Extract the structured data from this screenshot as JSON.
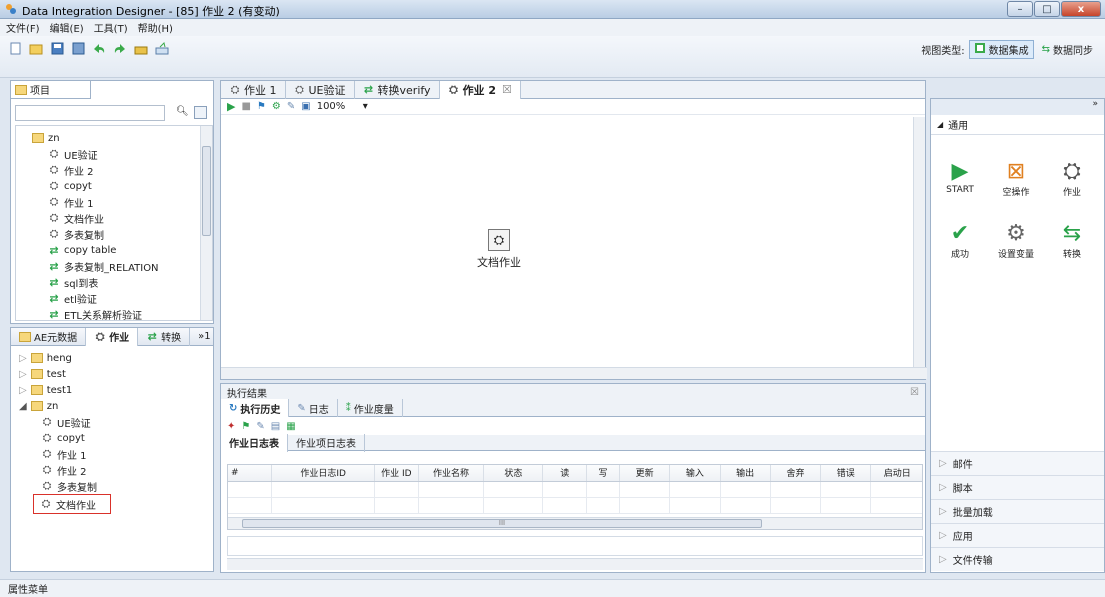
{
  "window": {
    "title": "Data Integration Designer - [85] 作业 2 (有变动)",
    "minimize": "–",
    "maximize": "□",
    "close": "x"
  },
  "menu": [
    "文件(F)",
    "编辑(E)",
    "工具(T)",
    "帮助(H)"
  ],
  "toolbar": {
    "view_type_label": "视图类型:",
    "view_integration": "数据集成",
    "view_sync": "数据同步"
  },
  "project_panel": {
    "title": "项目",
    "search_value": "",
    "root": "zn",
    "items": [
      {
        "label": "UE验证",
        "type": "job"
      },
      {
        "label": "作业 2",
        "type": "job"
      },
      {
        "label": "copyt",
        "type": "job"
      },
      {
        "label": "作业 1",
        "type": "job"
      },
      {
        "label": "文档作业",
        "type": "job"
      },
      {
        "label": "多表复制",
        "type": "job"
      },
      {
        "label": "copy table",
        "type": "trans"
      },
      {
        "label": "多表复制_RELATION",
        "type": "trans"
      },
      {
        "label": "sql到表",
        "type": "trans"
      },
      {
        "label": "etl验证",
        "type": "trans"
      },
      {
        "label": "ETL关系解析验证",
        "type": "trans"
      }
    ]
  },
  "lower_panel": {
    "tabs": [
      "AE元数据",
      "作业",
      "转换",
      "»1"
    ],
    "folders": [
      "heng",
      "test",
      "test1",
      "zn"
    ],
    "zn_items": [
      "UE验证",
      "copyt",
      "作业 1",
      "作业 2",
      "多表复制",
      "文档作业"
    ]
  },
  "editor": {
    "tabs": [
      "作业 1",
      "UE验证",
      "转换verify",
      "作业 2"
    ],
    "close_glyph": "☒",
    "zoom": "100%",
    "node_label": "文档作业"
  },
  "results": {
    "title": "执行结果",
    "tabs": [
      "执行历史",
      "日志",
      "作业度量"
    ],
    "subtabs": [
      "作业日志表",
      "作业项日志表"
    ],
    "columns": [
      "#",
      "作业日志ID",
      "作业 ID",
      "作业名称",
      "状态",
      "读",
      "写",
      "更新",
      "输入",
      "输出",
      "舍弃",
      "错误",
      "启动日"
    ],
    "scroll_mark": "III"
  },
  "palette": {
    "section": "通用",
    "items": [
      {
        "label": "START",
        "icon": "play-icon"
      },
      {
        "label": "空操作",
        "icon": "dummy-icon"
      },
      {
        "label": "作业",
        "icon": "job-icon"
      },
      {
        "label": "成功",
        "icon": "check-icon"
      },
      {
        "label": "设置变量",
        "icon": "variable-icon"
      },
      {
        "label": "转换",
        "icon": "transform-icon"
      }
    ],
    "sections": [
      "邮件",
      "脚本",
      "批量加载",
      "应用",
      "文件传输"
    ]
  },
  "status_bar": "属性菜单",
  "colors": {
    "accent": "#2aa24a",
    "selection_border": "#d9312a",
    "frame": "#9fb2c9"
  }
}
